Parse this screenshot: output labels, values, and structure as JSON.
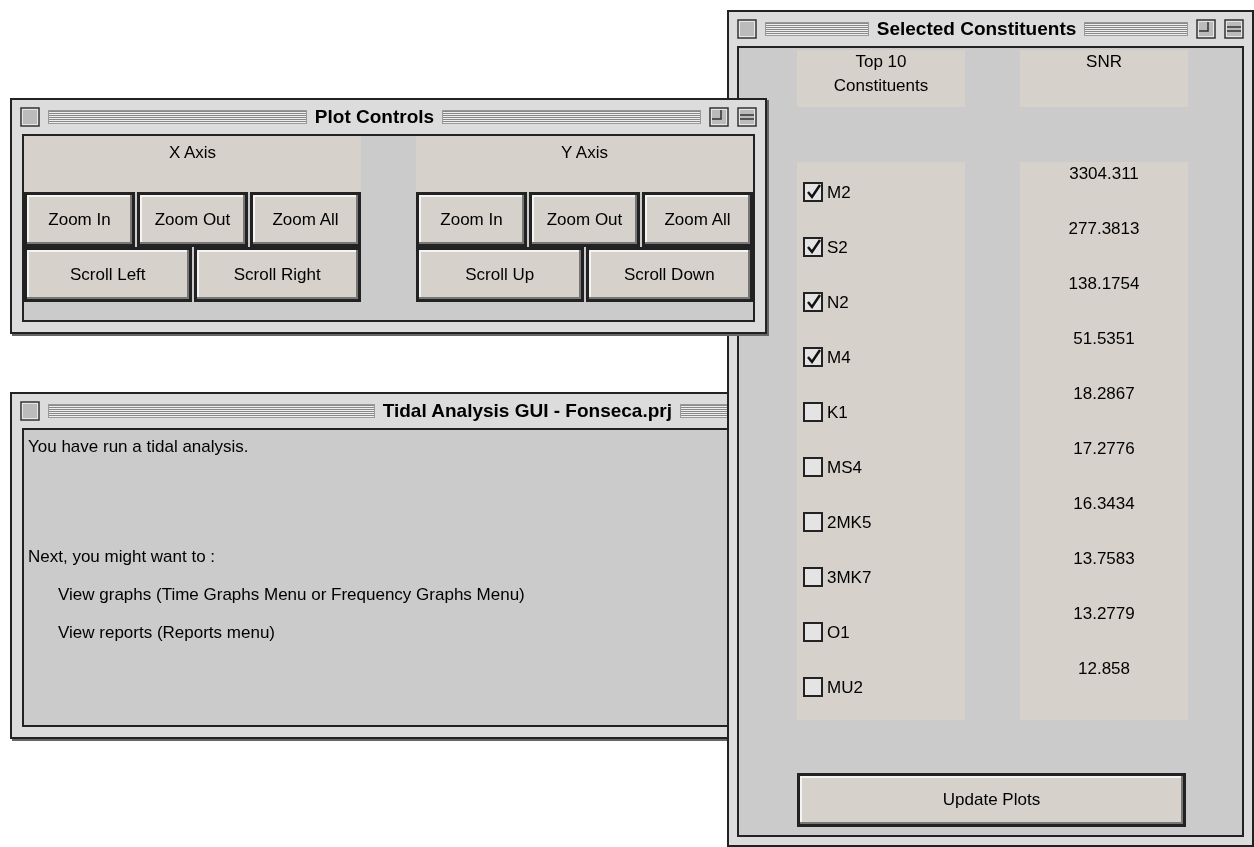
{
  "plot_controls": {
    "title": "Plot Controls",
    "groups": [
      {
        "label": "X Axis",
        "zoom_buttons": [
          "Zoom In",
          "Zoom Out",
          "Zoom All"
        ],
        "scroll_buttons": [
          "Scroll Left",
          "Scroll Right"
        ]
      },
      {
        "label": "Y Axis",
        "zoom_buttons": [
          "Zoom In",
          "Zoom Out",
          "Zoom All"
        ],
        "scroll_buttons": [
          "Scroll Up",
          "Scroll Down"
        ]
      }
    ]
  },
  "tidal_analysis": {
    "title": "Tidal Analysis GUI - Fonseca.prj",
    "lines": [
      {
        "text": "You have run a tidal analysis.",
        "indented": false
      },
      {
        "text": "Next, you might want to :",
        "indented": false
      },
      {
        "text": "View graphs (Time Graphs Menu or Frequency Graphs Menu)",
        "indented": true
      },
      {
        "text": "View reports (Reports menu)",
        "indented": true
      }
    ]
  },
  "selected_constituents": {
    "title": "Selected Constituents",
    "columns": [
      "Top 10 Constituents",
      "SNR"
    ],
    "rows": [
      {
        "name": "M2",
        "checked": true,
        "snr": "3304.311"
      },
      {
        "name": "S2",
        "checked": true,
        "snr": "277.3813"
      },
      {
        "name": "N2",
        "checked": true,
        "snr": "138.1754"
      },
      {
        "name": "M4",
        "checked": true,
        "snr": "51.5351"
      },
      {
        "name": "K1",
        "checked": false,
        "snr": "18.2867"
      },
      {
        "name": "MS4",
        "checked": false,
        "snr": "17.2776"
      },
      {
        "name": "2MK5",
        "checked": false,
        "snr": "16.3434"
      },
      {
        "name": "3MK7",
        "checked": false,
        "snr": "13.7583"
      },
      {
        "name": "O1",
        "checked": false,
        "snr": "13.2779"
      },
      {
        "name": "MU2",
        "checked": false,
        "snr": "12.858"
      }
    ],
    "button": "Update Plots"
  }
}
